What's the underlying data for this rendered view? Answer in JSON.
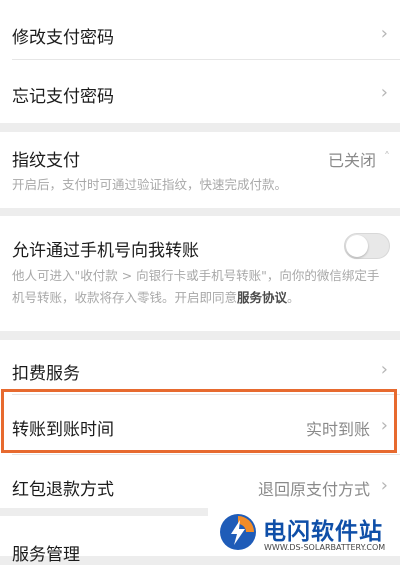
{
  "settings": {
    "change_password": {
      "label": "修改支付密码"
    },
    "forgot_password": {
      "label": "忘记支付密码"
    },
    "fingerprint": {
      "label": "指纹支付",
      "value": "已关闭",
      "description": "开启后，支付时可通过验证指纹，快速完成付款。"
    },
    "phone_transfer": {
      "label": "允许通过手机号向我转账",
      "enabled": false,
      "description": "他人可进入\"收付款 > 向银行卡或手机号转账\"，向你的微信绑定手机号转账，收款将存入零钱。开启即同意",
      "link": "服务协议",
      "description_end": "。"
    },
    "deduction_service": {
      "label": "扣费服务"
    },
    "transfer_arrival_time": {
      "label": "转账到账时间",
      "value": "实时到账"
    },
    "red_packet_refund": {
      "label": "红包退款方式",
      "value": "退回原支付方式"
    },
    "service_management": {
      "label": "服务管理"
    }
  },
  "watermark": {
    "title": "电闪软件站",
    "subtitle": "WWW.DS-SOLARBATTERY.COM"
  },
  "colors": {
    "highlight": "#e76a2f",
    "background": "#ededed"
  }
}
